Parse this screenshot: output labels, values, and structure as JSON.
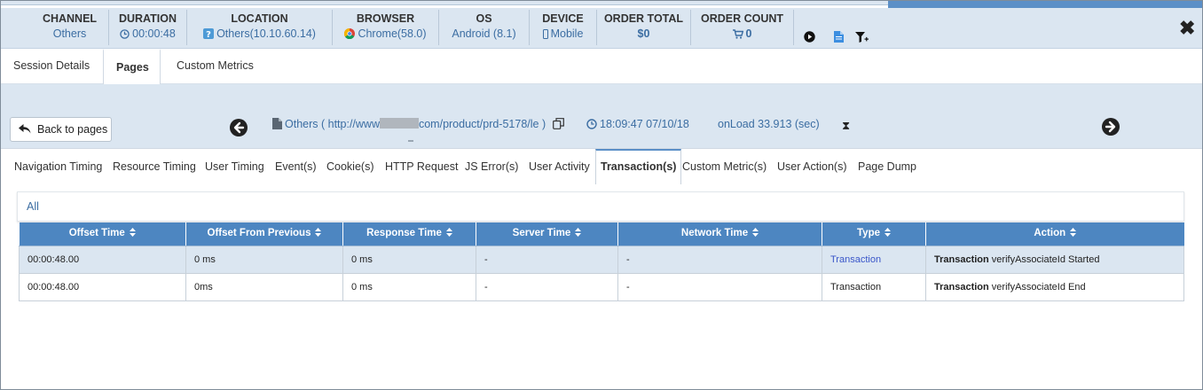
{
  "header": {
    "columns": [
      {
        "label": "CHANNEL",
        "value": "Others"
      },
      {
        "label": "DURATION",
        "value": "00:00:48"
      },
      {
        "label": "LOCATION",
        "value": "Others(10.10.60.14)"
      },
      {
        "label": "BROWSER",
        "value": "Chrome(58.0)"
      },
      {
        "label": "OS",
        "value": "Android (8.1)"
      },
      {
        "label": "DEVICE",
        "value": "Mobile"
      },
      {
        "label": "ORDER TOTAL",
        "value": "$0"
      },
      {
        "label": "ORDER COUNT",
        "value": "0"
      }
    ],
    "icons": [
      "play-circle-icon",
      "document-icon",
      "filter-add-icon"
    ],
    "close_label": "✖"
  },
  "main_tabs": [
    {
      "label": "Session Details",
      "active": false
    },
    {
      "label": "Pages",
      "active": true
    },
    {
      "label": "Custom Metrics",
      "active": false
    }
  ],
  "page_bar": {
    "back_label": "Back to pages",
    "url_prefix": "Others ( http://www",
    "url_suffix": "com/product/prd-5178/le )",
    "time": "18:09:47 07/10/18",
    "onload": "onLoad 33.913 (sec)",
    "hourglass": "⧗"
  },
  "sub_tabs": [
    {
      "label": "Navigation Timing",
      "active": false
    },
    {
      "label": "Resource Timing",
      "active": false
    },
    {
      "label": "User Timing",
      "active": false
    },
    {
      "label": "Event(s)",
      "active": false
    },
    {
      "label": "Cookie(s)",
      "active": false
    },
    {
      "label": "HTTP Request",
      "active": false
    },
    {
      "label": "JS Error(s)",
      "active": false
    },
    {
      "label": "User Activity",
      "active": false
    },
    {
      "label": "Transaction(s)",
      "active": true
    },
    {
      "label": "Custom Metric(s)",
      "active": false
    },
    {
      "label": "User Action(s)",
      "active": false
    },
    {
      "label": "Page Dump",
      "active": false
    }
  ],
  "filter": {
    "label": "All"
  },
  "table": {
    "columns": [
      "Offset Time",
      "Offset From Previous",
      "Response Time",
      "Server Time",
      "Network Time",
      "Type",
      "Action"
    ],
    "rows": [
      {
        "offset_time": "00:00:48.00",
        "offset_prev": "0 ms",
        "response": "0 ms",
        "server": "-",
        "network": "-",
        "type": "Transaction",
        "action_bold": "Transaction",
        "action_rest": " verifyAssociateId Started",
        "selected": true
      },
      {
        "offset_time": "00:00:48.00",
        "offset_prev": "0ms",
        "response": "0 ms",
        "server": "-",
        "network": "-",
        "type": "Transaction",
        "action_bold": "Transaction",
        "action_rest": " verifyAssociateId End",
        "selected": false
      }
    ]
  },
  "colors": {
    "header_bg": "#dbe6f1",
    "table_header": "#4d86c1",
    "link": "#3b6da2",
    "selected_row": "#dbe6f1"
  }
}
